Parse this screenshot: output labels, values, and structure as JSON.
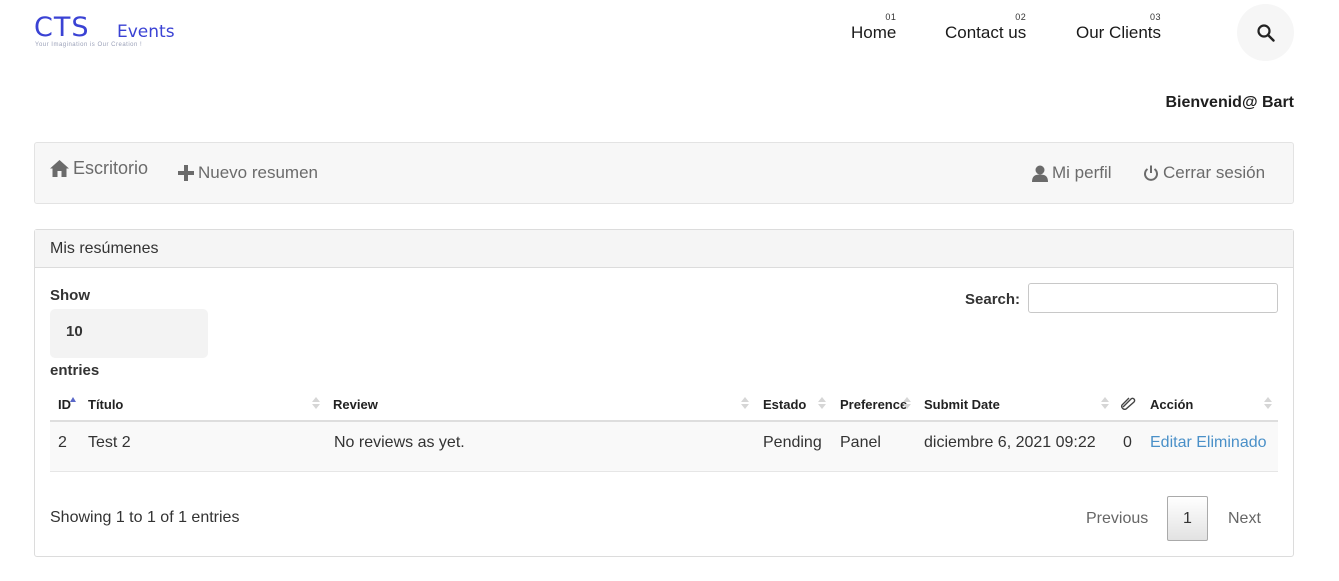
{
  "header": {
    "logo": {
      "main": "CTS",
      "sub": "Events",
      "tagline": "Your Imagination is Our Creation !"
    },
    "nav": [
      {
        "num": "01",
        "label": "Home"
      },
      {
        "num": "02",
        "label": "Contact us"
      },
      {
        "num": "03",
        "label": "Our Clients"
      }
    ],
    "search_icon": "search-icon"
  },
  "welcome": "Bienvenid@ Bart",
  "toolbar": {
    "home": {
      "icon": "home-icon",
      "label": "Escritorio"
    },
    "new": {
      "icon": "plus-icon",
      "label": "Nuevo resumen"
    },
    "profile": {
      "icon": "user-icon",
      "label": "Mi perfil"
    },
    "logout": {
      "icon": "power-icon",
      "label": "Cerrar sesión"
    }
  },
  "panel": {
    "title": "Mis resúmenes",
    "length": {
      "show_label": "Show",
      "value": "10",
      "entries_label": "entries"
    },
    "search": {
      "label": "Search:",
      "value": "",
      "placeholder": ""
    },
    "columns": [
      "ID",
      "Título",
      "Review",
      "Estado",
      "Preference",
      "Submit Date",
      "attachment-icon",
      "Acción"
    ],
    "rows": [
      {
        "id": "2",
        "titulo": "Test 2",
        "review": "No reviews as yet.",
        "estado": "Pending",
        "preference": "Panel",
        "submit_date": "diciembre 6, 2021 09:22",
        "attachments": "0",
        "actions": [
          "Editar",
          "Eliminado"
        ]
      }
    ],
    "info": "Showing 1 to 1 of 1 entries",
    "pagination": {
      "previous": "Previous",
      "current": "1",
      "next": "Next"
    }
  },
  "colors": {
    "logo": "#3a42d4",
    "link": "#4a90c8",
    "sort_active": "#5a68c8"
  }
}
